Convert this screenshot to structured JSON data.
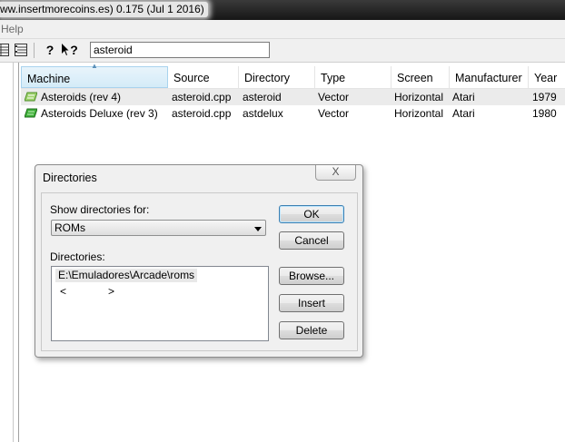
{
  "window": {
    "title": "ww.insertmorecoins.es) 0.175 (Jul  1 2016)"
  },
  "menu": {
    "help": "Help"
  },
  "toolbar": {
    "search_value": "asteroid",
    "help_glyph": "?",
    "whatsthis_glyph": "?"
  },
  "columns": [
    "Machine",
    "Source",
    "Directory",
    "Type",
    "Screen",
    "Manufacturer",
    "Year"
  ],
  "games": [
    {
      "machine": "Asteroids (rev 4)",
      "source": "asteroid.cpp",
      "directory": "asteroid",
      "type": "Vector",
      "screen": "Horizontal",
      "manufacturer": "Atari",
      "year": "1979",
      "icon": "green-rom-icon"
    },
    {
      "machine": "Asteroids Deluxe (rev 3)",
      "source": "asteroid.cpp",
      "directory": "astdelux",
      "type": "Vector",
      "screen": "Horizontal",
      "manufacturer": "Atari",
      "year": "1980",
      "icon": "green-rom-icon"
    }
  ],
  "dialog": {
    "title": "Directories",
    "close": "X",
    "show_label": "Show directories for:",
    "combo_value": "ROMs",
    "dirs_label": "Directories:",
    "dirs": [
      "E:\\Emuladores\\Arcade\\roms"
    ],
    "new_entry_left": "<",
    "new_entry_right": ">",
    "buttons": {
      "ok": "OK",
      "cancel": "Cancel",
      "browse": "Browse...",
      "insert": "Insert",
      "delete": "Delete"
    }
  }
}
